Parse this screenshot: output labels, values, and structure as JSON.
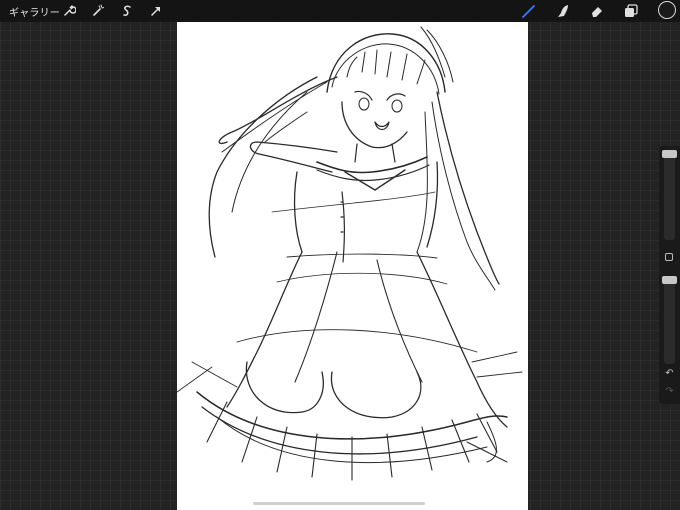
{
  "topbar": {
    "gallery_label": "ギャラリー",
    "left_tools": [
      "wrench-icon",
      "magic-wand-icon",
      "selection-icon",
      "transform-arrow-icon"
    ],
    "right_tools": [
      "brush-icon",
      "smudge-icon",
      "eraser-icon",
      "layers-icon"
    ],
    "active_tool": "brush-icon",
    "active_tool_color": "#3a7bf5",
    "current_color": "#1a1a1a"
  },
  "sidebar": {
    "brush_size_level": 0.0,
    "opacity_level": 0.0,
    "buttons": [
      "modify-icon",
      "undo-icon",
      "redo-icon"
    ]
  },
  "canvas": {
    "background": "#ffffff",
    "content": "sketch-drawing"
  }
}
